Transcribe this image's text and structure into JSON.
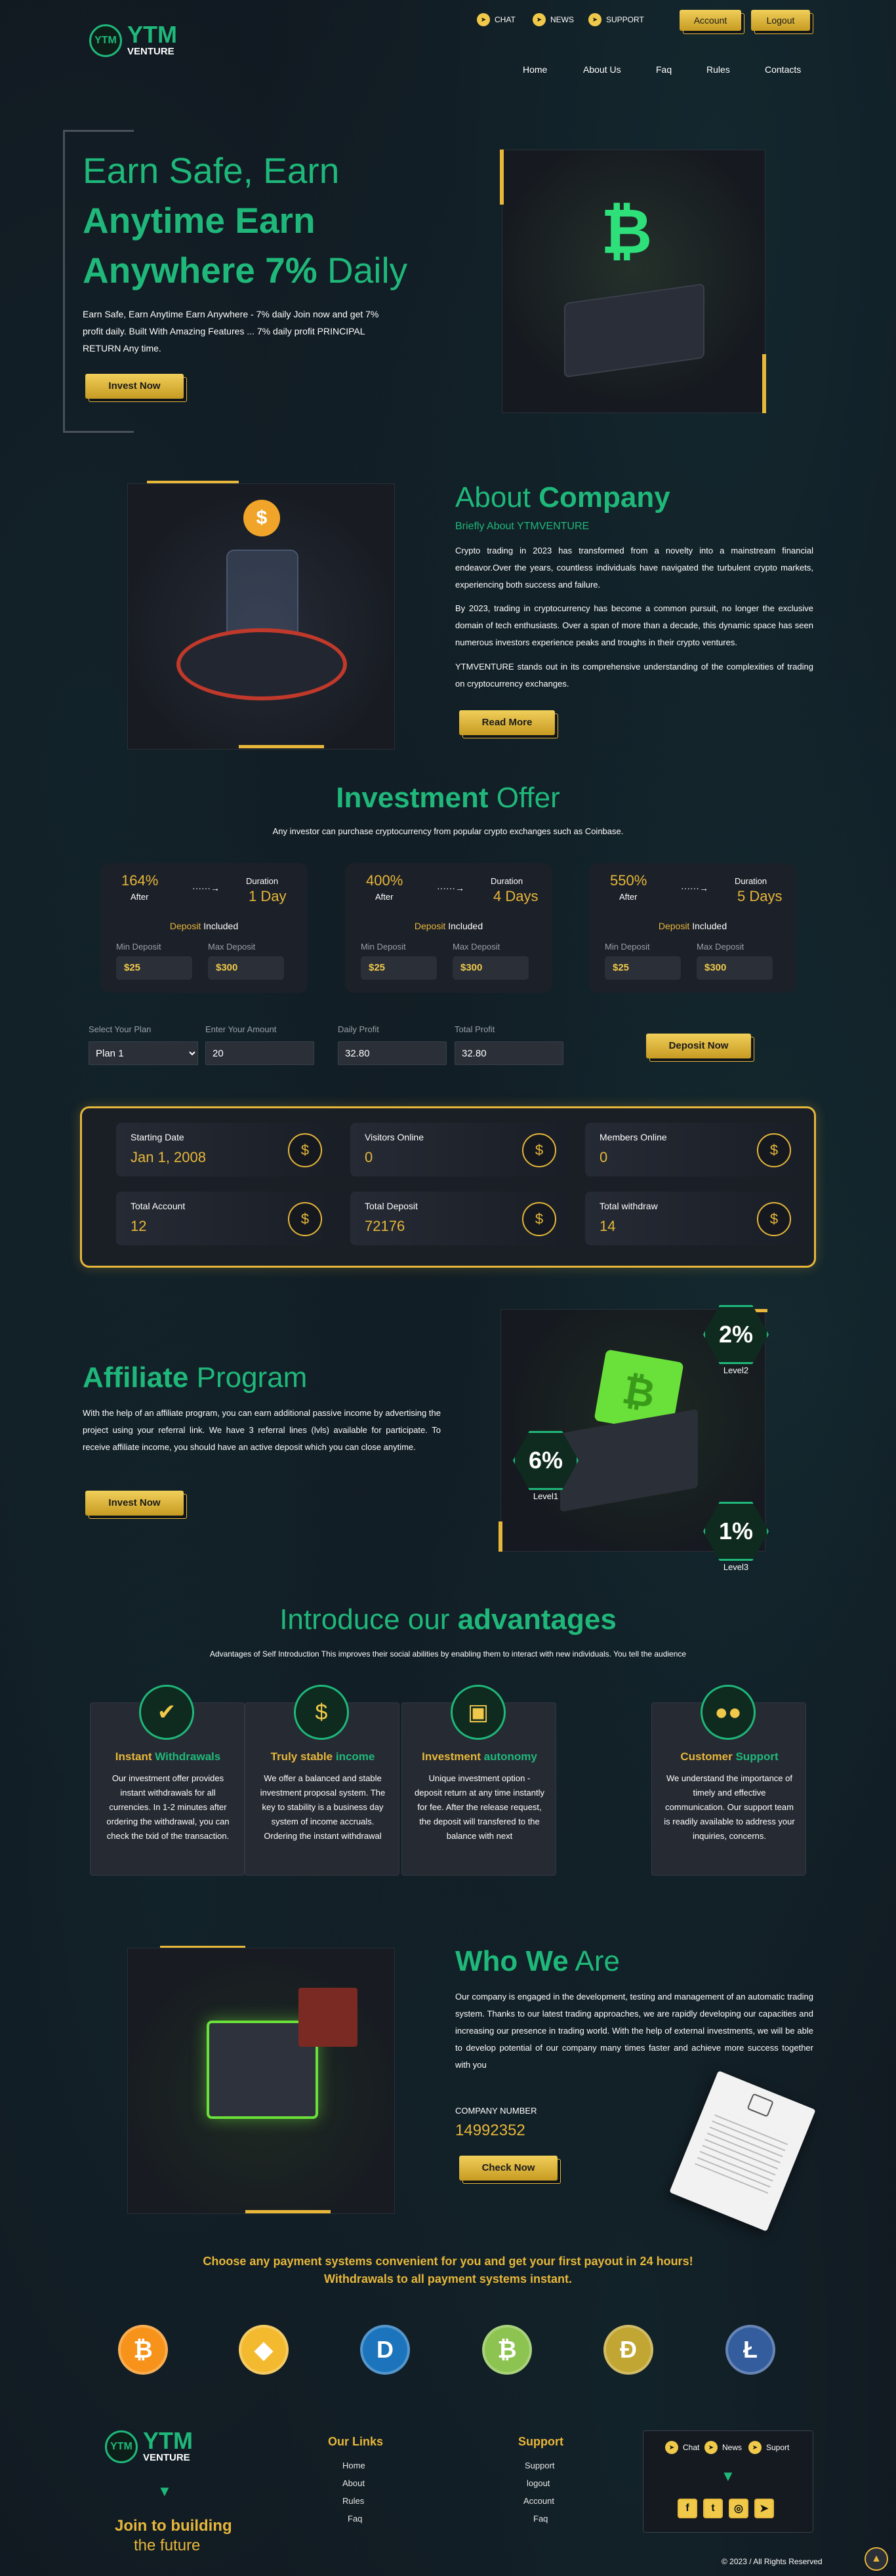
{
  "brand": {
    "name": "YTM",
    "sub": "VENTURE"
  },
  "topbar": {
    "chat": "CHAT",
    "news": "NEWS",
    "support": "SUPPORT",
    "account": "Account",
    "logout": "Logout"
  },
  "nav": [
    "Home",
    "About Us",
    "Faq",
    "Rules",
    "Contacts"
  ],
  "hero": {
    "line1": "Earn Safe, Earn",
    "line2_bold": "Anytime Earn",
    "line3_bold": "Anywhere 7%",
    "line3_light": "Daily",
    "desc": "Earn Safe, Earn Anytime Earn Anywhere - 7% daily Join now and get 7% profit daily. Built With Amazing Features ... 7% daily profit PRINCIPAL RETURN Any time.",
    "button": "Invest Now"
  },
  "about": {
    "title_light": "About",
    "title_bold": "Company",
    "subtitle": "Briefly About YTMVENTURE",
    "p1": "Crypto trading in 2023 has transformed from a novelty into a mainstream financial endeavor.Over the years, countless individuals have navigated the turbulent crypto markets, experiencing both success and failure.",
    "p2": "By 2023, trading in cryptocurrency has become a common pursuit, no longer the exclusive domain of tech enthusiasts. Over a span of more than a decade, this dynamic space has seen numerous investors experience peaks and troughs in their crypto ventures.",
    "p3": "YTMVENTURE stands out in its comprehensive understanding of the complexities of trading on cryptocurrency exchanges.",
    "button": "Read More"
  },
  "offer": {
    "title_bold": "Investment",
    "title_light": "Offer",
    "subtitle": "Any investor can purchase cryptocurrency from popular crypto exchanges such as Coinbase.",
    "plans": [
      {
        "percent": "164%",
        "after": "After",
        "duration_label": "Duration",
        "duration": "1 Day",
        "deposit": "Deposit",
        "included": "Included",
        "min_label": "Min Deposit",
        "max_label": "Max Deposit",
        "min": "$25",
        "max": "$300"
      },
      {
        "percent": "400%",
        "after": "After",
        "duration_label": "Duration",
        "duration": "4 Days",
        "deposit": "Deposit",
        "included": "Included",
        "min_label": "Min Deposit",
        "max_label": "Max Deposit",
        "min": "$25",
        "max": "$300"
      },
      {
        "percent": "550%",
        "after": "After",
        "duration_label": "Duration",
        "duration": "5 Days",
        "deposit": "Deposit",
        "included": "Included",
        "min_label": "Min Deposit",
        "max_label": "Max Deposit",
        "min": "$25",
        "max": "$300"
      }
    ]
  },
  "calc": {
    "plan_label": "Select Your Plan",
    "plan_value": "Plan 1",
    "amount_label": "Enter Your Amount",
    "amount_value": "20",
    "daily_label": "Daily Profit",
    "daily_value": "32.80",
    "total_label": "Total Profit",
    "total_value": "32.80",
    "button": "Deposit Now"
  },
  "stats": [
    {
      "label": "Starting Date",
      "value": "Jan 1, 2008"
    },
    {
      "label": "Visitors Online",
      "value": "0"
    },
    {
      "label": "Members Online",
      "value": "0"
    },
    {
      "label": "Total Account",
      "value": "12"
    },
    {
      "label": "Total Deposit",
      "value": "72176"
    },
    {
      "label": "Total withdraw",
      "value": "14"
    }
  ],
  "affiliate": {
    "title_bold": "Affiliate",
    "title_light": "Program",
    "desc": "With the help of an affiliate program, you can earn additional passive income by advertising the project using your referral link. We have 3 referral lines (lvls) available for participate. To receive affiliate income, you should have an active deposit which you can close anytime.",
    "button": "Invest Now",
    "levels": [
      {
        "pct": "2%",
        "name": "Level2"
      },
      {
        "pct": "6%",
        "name": "Level1"
      },
      {
        "pct": "1%",
        "name": "Level3"
      }
    ]
  },
  "advantages": {
    "title_light": "Introduce our",
    "title_bold": "advantages",
    "subtitle": "Advantages of Self Introduction This improves their social abilities by enabling them to interact with new individuals. You tell the audience",
    "items": [
      {
        "t1": "Instant",
        "t2": "Withdrawals",
        "text": "Our investment offer provides instant withdrawals for all currencies. In 1-2 minutes after ordering the withdrawal, you can check the txid of the transaction."
      },
      {
        "t1": "Truly stable",
        "t2": "income",
        "text": "We offer a balanced and stable investment proposal system. The key to stability is a business day system of income accruals. Ordering the instant withdrawal"
      },
      {
        "t1": "Investment",
        "t2": "autonomy",
        "text": "Unique investment option - deposit return at any time instantly for fee. After the release request, the deposit will transfered to the balance with next"
      },
      {
        "t1": "Customer",
        "t2": "Support",
        "text": "We understand the importance of timely and effective communication. Our support team is readily available to address your inquiries, concerns."
      }
    ]
  },
  "who": {
    "title_bold": "Who We",
    "title_light": "Are",
    "desc": "Our company is engaged in the development, testing and management of an automatic trading system. Thanks to our latest trading approaches, we are rapidly developing our capacities and increasing our presence in trading world. With the help of external investments, we will be able to develop potential of our company many times faster and achieve more success together with you",
    "company_label": "COMPANY NUMBER",
    "company_number": "14992352",
    "button": "Check Now"
  },
  "payment": {
    "line1": "Choose any payment systems convenient for you and get your first payout in 24 hours!",
    "line2": "Withdrawals to all payment systems instant."
  },
  "footer": {
    "join1": "Join to building",
    "join2": "the future",
    "links_title": "Our Links",
    "links": [
      "Home",
      "About",
      "Rules",
      "Faq"
    ],
    "support_title": "Support",
    "support_links": [
      "Support",
      "logout",
      "Account",
      "Faq"
    ],
    "box": {
      "chat": "Chat",
      "news": "News",
      "support": "Suport"
    },
    "copyright": "© 2023 / All Rights Reserved"
  },
  "colors": {
    "green": "#1fb87a",
    "gold": "#e7b73a",
    "bg": "#111820"
  }
}
